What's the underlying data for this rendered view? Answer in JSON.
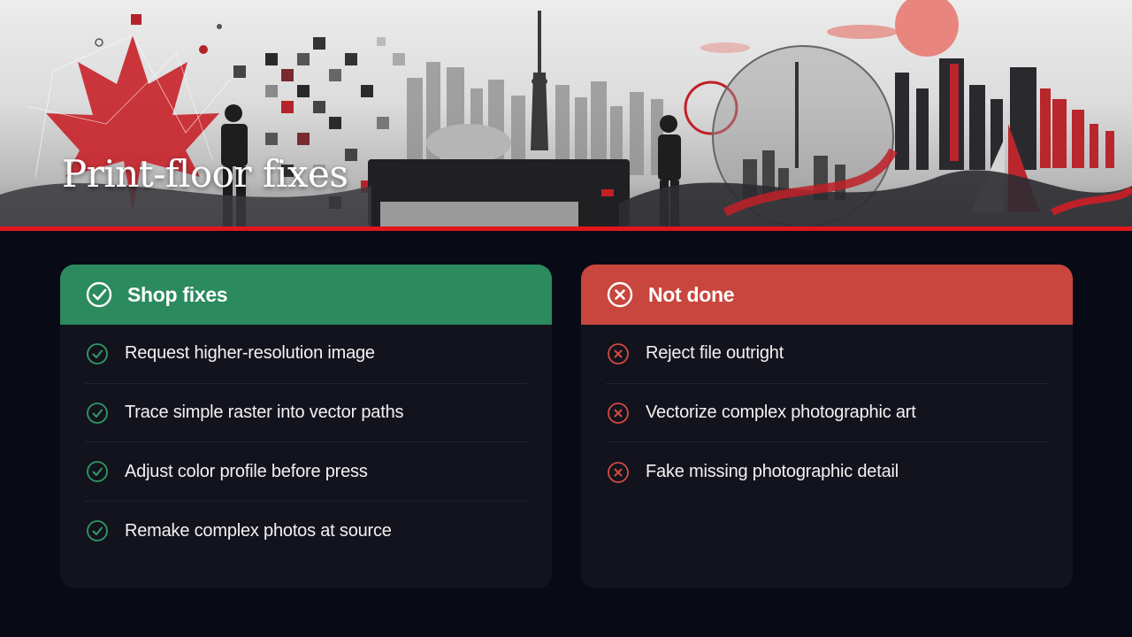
{
  "hero": {
    "title": "Print-floor fixes"
  },
  "theme": {
    "accent_red": "#e0161c",
    "positive": "#2b8a5e",
    "negative": "#c8463d",
    "background": "#080a16"
  },
  "cards": {
    "fixes": {
      "title": "Shop fixes",
      "icon": "check-circle-icon",
      "items": [
        "Request higher-resolution image",
        "Trace simple raster into vector paths",
        "Adjust color profile before press",
        "Remake complex photos at source"
      ]
    },
    "not_done": {
      "title": "Not done",
      "icon": "x-circle-icon",
      "items": [
        "Reject file outright",
        "Vectorize complex photographic art",
        "Fake missing photographic detail"
      ]
    }
  }
}
